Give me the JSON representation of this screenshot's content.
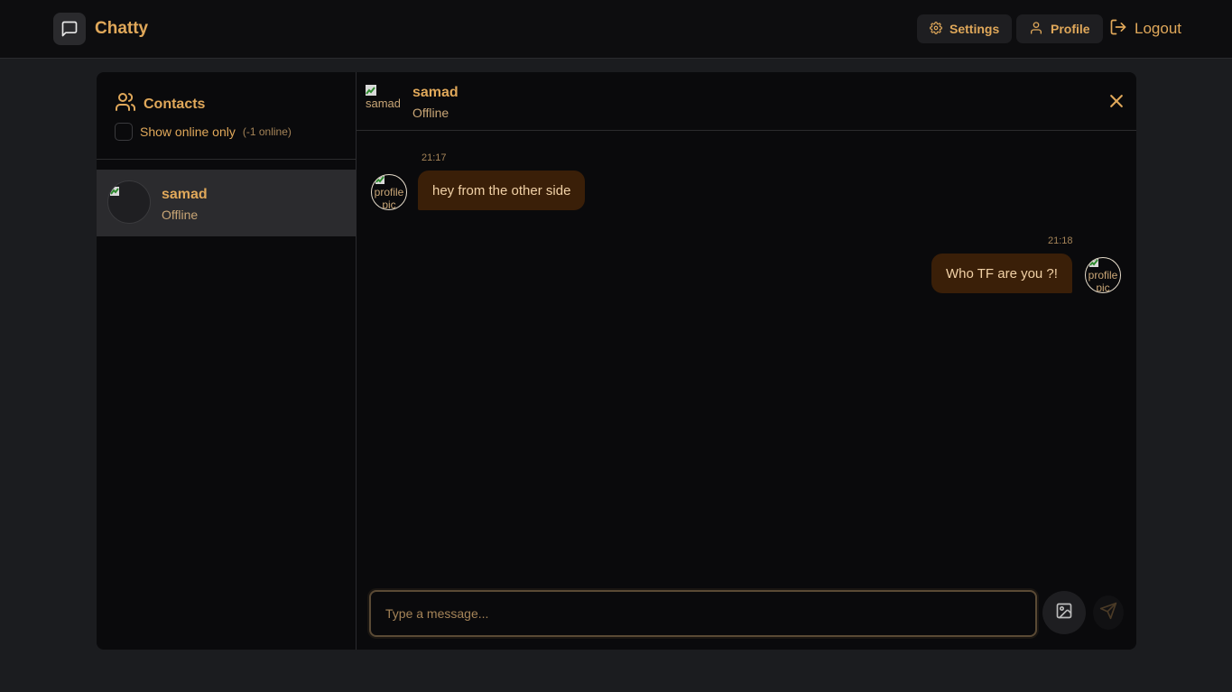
{
  "app": {
    "name": "Chatty"
  },
  "nav": {
    "settings_label": "Settings",
    "profile_label": "Profile",
    "logout_label": "Logout"
  },
  "sidebar": {
    "title": "Contacts",
    "online_filter_label": "Show online only",
    "online_count": "(-1 online)",
    "contacts": [
      {
        "name": "samad",
        "status": "Offline",
        "avatar_alt": "samad"
      }
    ]
  },
  "chat": {
    "contact_name": "samad",
    "contact_status": "Offline",
    "contact_avatar_alt": "samad",
    "messages": [
      {
        "time": "21:17",
        "text": "hey from the other side",
        "avatar_alt": "profile pic",
        "side": "left"
      },
      {
        "time": "21:18",
        "text": "Who TF are you ?!",
        "avatar_alt": "profile pic",
        "side": "right"
      }
    ],
    "input_placeholder": "Type a message..."
  },
  "colors": {
    "accent": "#e0a85a",
    "bubble": "#3a1f08",
    "background": "#1b1c1f",
    "panel": "#0a0a0c"
  }
}
